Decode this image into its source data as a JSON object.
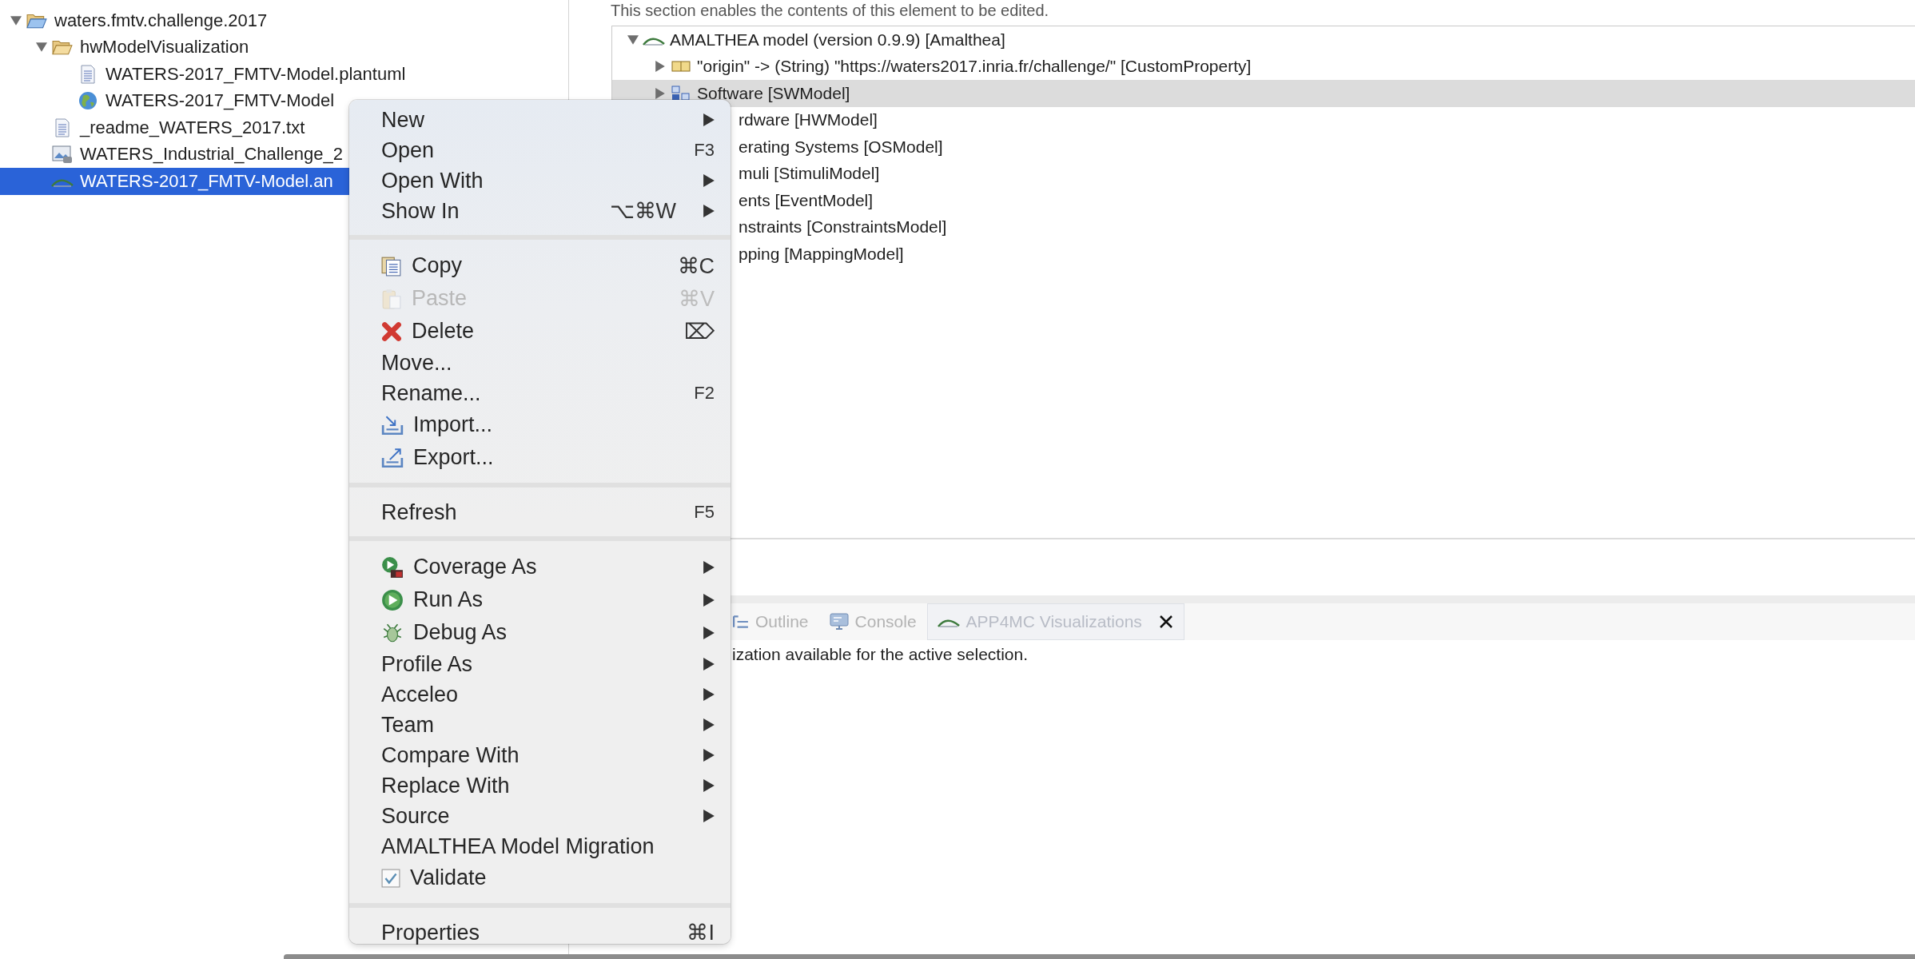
{
  "explorer": {
    "tree": [
      {
        "label": "waters.fmtv.challenge.2017",
        "kind": "project",
        "expanded": true,
        "selected": false,
        "children": [
          {
            "label": "hwModelVisualization",
            "kind": "folder",
            "expanded": true,
            "selected": false,
            "children": [
              {
                "label": "WATERS-2017_FMTV-Model.plantuml",
                "kind": "text",
                "selected": false
              },
              {
                "label": "WATERS-2017_FMTV-Model",
                "kind": "web",
                "selected": false
              }
            ]
          },
          {
            "label": "_readme_WATERS_2017.txt",
            "kind": "text",
            "selected": false
          },
          {
            "label": "WATERS_Industrial_Challenge_2",
            "kind": "image",
            "selected": false
          },
          {
            "label": "WATERS-2017_FMTV-Model.an",
            "kind": "model",
            "selected": true
          }
        ]
      }
    ]
  },
  "editor": {
    "description": "This section enables the contents of this element to be edited.",
    "tree": [
      {
        "label": "AMALTHEA model (version 0.9.9) [Amalthea]",
        "kind": "model",
        "expanded": true,
        "selected": false,
        "children": [
          {
            "label": "\"origin\" -> (String) \"https://waters2017.inria.fr/challenge/\" [CustomProperty]",
            "kind": "property",
            "expanded": false,
            "selected": false
          },
          {
            "label": "Software [SWModel]",
            "kind": "software",
            "expanded": false,
            "selected": true
          },
          {
            "label": "rdware [HWModel]",
            "kind": "clipped",
            "selected": false
          },
          {
            "label": "erating Systems [OSModel]",
            "kind": "clipped",
            "selected": false
          },
          {
            "label": "muli [StimuliModel]",
            "kind": "clipped",
            "selected": false
          },
          {
            "label": "ents [EventModel]",
            "kind": "clipped",
            "selected": false
          },
          {
            "label": "nstraints [ConstraintsModel]",
            "kind": "clipped",
            "selected": false
          },
          {
            "label": "pping [MappingModel]",
            "kind": "clipped",
            "selected": false
          }
        ]
      }
    ]
  },
  "views": {
    "tabs": [
      {
        "label": "Outline",
        "kind": "outline",
        "selected": false
      },
      {
        "label": "Console",
        "kind": "console",
        "selected": false
      },
      {
        "label": "APP4MC Visualizations",
        "kind": "model",
        "selected": true
      }
    ],
    "message": "ization available for the active selection."
  },
  "context_menu": {
    "groups": [
      [
        {
          "label": "New",
          "kind": "plain",
          "submenu": true,
          "disabled": false
        },
        {
          "label": "Open",
          "kind": "plain",
          "shortcut": "F3",
          "submenu": false,
          "disabled": false
        },
        {
          "label": "Open With",
          "kind": "plain",
          "submenu": true,
          "disabled": false
        },
        {
          "label": "Show In",
          "kind": "plain",
          "shortcut": "⌥⌘W",
          "submenu": true,
          "disabled": false
        }
      ],
      [
        {
          "label": "Copy",
          "kind": "copy",
          "shortcut": "⌘C",
          "submenu": false,
          "disabled": false
        },
        {
          "label": "Paste",
          "kind": "paste",
          "shortcut": "⌘V",
          "submenu": false,
          "disabled": true
        },
        {
          "label": "Delete",
          "kind": "delete",
          "shortcut": "⌦",
          "submenu": false,
          "disabled": false
        },
        {
          "label": "Move...",
          "kind": "plain",
          "submenu": false,
          "disabled": false
        },
        {
          "label": "Rename...",
          "kind": "plain",
          "shortcut": "F2",
          "submenu": false,
          "disabled": false
        },
        {
          "label": "Import...",
          "kind": "import",
          "submenu": false,
          "disabled": false
        },
        {
          "label": "Export...",
          "kind": "export",
          "submenu": false,
          "disabled": false
        }
      ],
      [
        {
          "label": "Refresh",
          "kind": "plain",
          "shortcut": "F5",
          "submenu": false,
          "disabled": false
        }
      ],
      [
        {
          "label": "Coverage As",
          "kind": "coverage",
          "submenu": true,
          "disabled": false
        },
        {
          "label": "Run As",
          "kind": "run",
          "submenu": true,
          "disabled": false
        },
        {
          "label": "Debug As",
          "kind": "debug",
          "submenu": true,
          "disabled": false
        },
        {
          "label": "Profile As",
          "kind": "plain",
          "submenu": true,
          "disabled": false
        },
        {
          "label": "Acceleo",
          "kind": "plain",
          "submenu": true,
          "disabled": false
        },
        {
          "label": "Team",
          "kind": "plain",
          "submenu": true,
          "disabled": false
        },
        {
          "label": "Compare With",
          "kind": "plain",
          "submenu": true,
          "disabled": false
        },
        {
          "label": "Replace With",
          "kind": "plain",
          "submenu": true,
          "disabled": false
        },
        {
          "label": "Source",
          "kind": "plain",
          "submenu": true,
          "disabled": false
        },
        {
          "label": "AMALTHEA Model Migration",
          "kind": "plain",
          "submenu": false,
          "disabled": false
        },
        {
          "label": "Validate",
          "kind": "check",
          "checked": true,
          "submenu": false,
          "disabled": false
        }
      ],
      [
        {
          "label": "Properties",
          "kind": "plain",
          "shortcut": "⌘I",
          "submenu": false,
          "disabled": false
        }
      ]
    ]
  }
}
